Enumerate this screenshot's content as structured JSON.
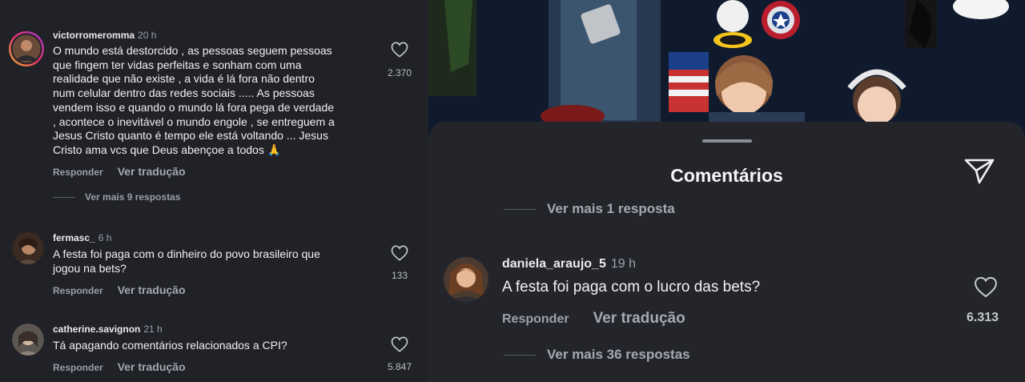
{
  "left_panel": {
    "comments": [
      {
        "username": "victorromeromma",
        "time": "20 h",
        "lines": [
          "O mundo está destorcido , as pessoas seguem pessoas",
          "que fingem ter vidas perfeitas e sonham com uma",
          "realidade que não existe , a vida é lá fora não dentro",
          "num celular dentro das redes sociais ..... As pessoas",
          "vendem isso e quando o mundo lá fora pega de verdade",
          ", acontece o inevitável o mundo engole , se entreguem a",
          "Jesus Cristo quanto é tempo ele está voltando ... Jesus",
          "Cristo ama vcs que Deus abençoe a todos 🙏"
        ],
        "likes": "2.370",
        "reply_label": "Responder",
        "translate_label": "Ver tradução",
        "more_replies": "Ver mais 9 respostas"
      },
      {
        "username": "fermasc_",
        "time": "6 h",
        "lines": [
          "A festa foi paga com o dinheiro do povo brasileiro que",
          "jogou na bets?"
        ],
        "likes": "133",
        "reply_label": "Responder",
        "translate_label": "Ver tradução"
      },
      {
        "username": "catherine.savignon",
        "time": "21 h",
        "lines": [
          "Tá apagando comentários relacionados a CPI?"
        ],
        "likes": "5.847",
        "reply_label": "Responder",
        "translate_label": "Ver tradução"
      }
    ]
  },
  "right_panel": {
    "sheet_title": "Comentários",
    "top_more_replies": "Ver mais 1 resposta",
    "comment": {
      "username": "daniela_araujo_5",
      "time": "19 h",
      "text": "A festa foi paga com o lucro das bets?",
      "likes": "6.313",
      "reply_label": "Responder",
      "translate_label": "Ver tradução",
      "more_replies": "Ver mais 36 respostas"
    }
  },
  "colors": {
    "left_bg": "#202227",
    "sheet_bg": "#23252b",
    "muted_text": "#9a9ea6",
    "story_ring": "#f0b030"
  }
}
